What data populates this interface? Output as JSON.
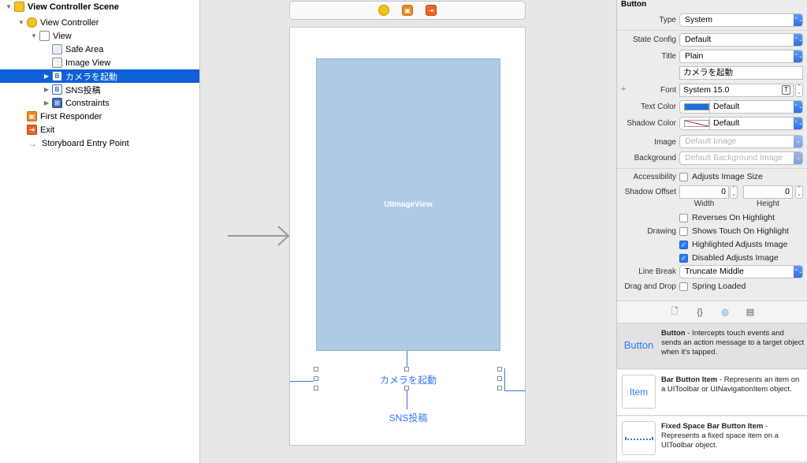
{
  "outline": {
    "scene": "View Controller Scene",
    "view_controller": "View Controller",
    "view": "View",
    "safe_area": "Safe Area",
    "image_view": "Image View",
    "camera_button": "カメラを起動",
    "sns_button": "SNS投稿",
    "constraints": "Constraints",
    "first_responder": "First Responder",
    "exit": "Exit",
    "entry_point": "Storyboard Entry Point"
  },
  "canvas": {
    "image_view_label": "UIImageView",
    "camera_button_label": "カメラを起動",
    "sns_button_label": "SNS投稿"
  },
  "inspector": {
    "section": "Button",
    "type_label": "Type",
    "type_value": "System",
    "state_config_label": "State Config",
    "state_config_value": "Default",
    "title_label": "Title",
    "title_value": "Plain",
    "title_text": "カメラを起動",
    "font_label": "Font",
    "font_value": "System 15.0",
    "text_color_label": "Text Color",
    "text_color_value": "Default",
    "shadow_color_label": "Shadow Color",
    "shadow_color_value": "Default",
    "image_label": "Image",
    "image_placeholder": "Default Image",
    "background_label": "Background",
    "background_placeholder": "Default Background Image",
    "accessibility_label": "Accessibility",
    "adjusts_image_size": "Adjusts Image Size",
    "shadow_offset_label": "Shadow Offset",
    "shadow_width": "0",
    "shadow_height": "0",
    "width_label": "Width",
    "height_label": "Height",
    "reverses_on_highlight": "Reverses On Highlight",
    "drawing_label": "Drawing",
    "shows_touch": "Shows Touch On Highlight",
    "highlighted_adjusts": "Highlighted Adjusts Image",
    "disabled_adjusts": "Disabled Adjusts Image",
    "line_break_label": "Line Break",
    "line_break_value": "Truncate Middle",
    "drag_drop_label": "Drag and Drop",
    "spring_loaded": "Spring Loaded",
    "checkbox_states": {
      "adjusts_image_size": false,
      "reverses_on_highlight": false,
      "shows_touch": false,
      "highlighted_adjusts": true,
      "disabled_adjusts": true,
      "spring_loaded": false
    },
    "colors": {
      "text_color_swatch": "#1d6fe0",
      "accent": "#2f7bf0"
    }
  },
  "library": {
    "tabs": [
      "file-icon",
      "braces-icon",
      "object-icon",
      "media-icon"
    ],
    "items": [
      {
        "icon_text": "Button",
        "title": "Button",
        "desc": " - Intercepts touch events and sends an action message to a target object when it's tapped."
      },
      {
        "icon_text": "Item",
        "title": "Bar Button Item",
        "desc": " - Represents an item on a UIToolbar or UINavigationItem object."
      },
      {
        "icon_text": "",
        "title": "Fixed Space Bar Button Item",
        "desc": " - Represents a fixed space item on a UIToolbar object."
      }
    ]
  }
}
